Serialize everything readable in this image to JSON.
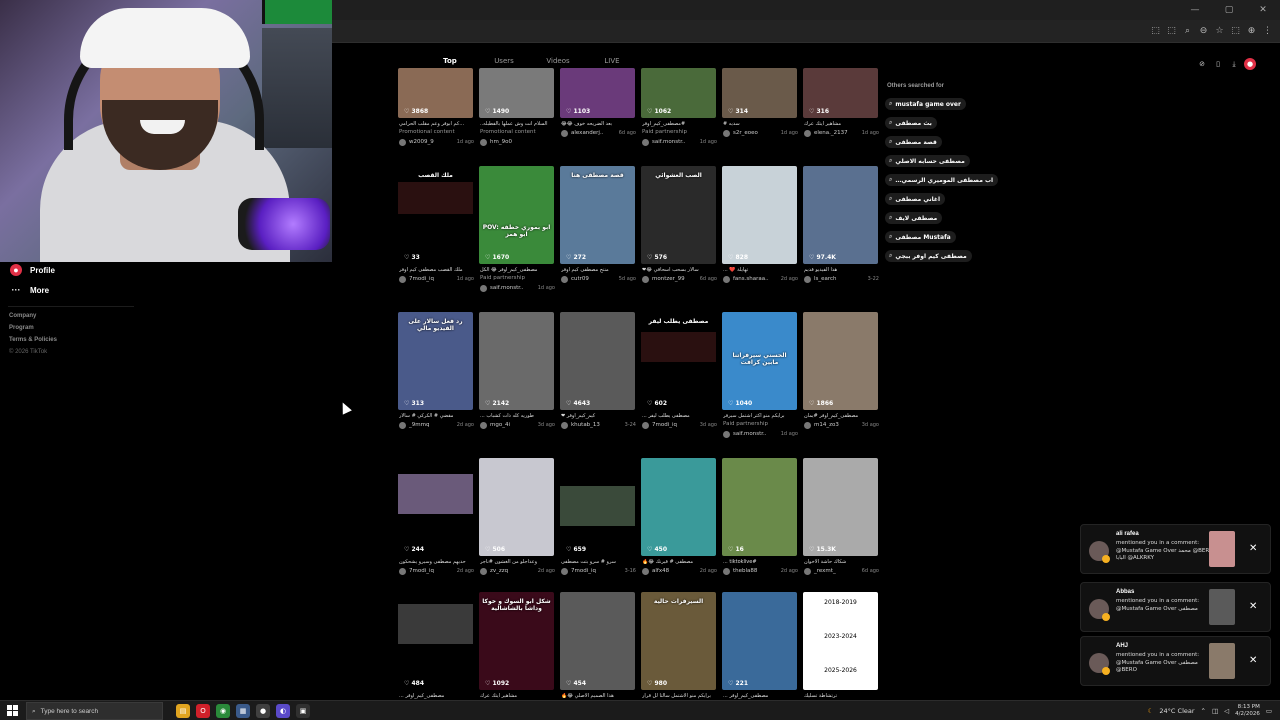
{
  "chrome": {
    "window_controls": [
      "—",
      "▢",
      "✕"
    ],
    "toolbar_icons": [
      "⬚",
      "⬚",
      "⌕",
      "⊖",
      "☆",
      "⬚",
      "⊕",
      "⋮"
    ]
  },
  "leftnav": {
    "profile_label": "Profile",
    "more_label": "More",
    "footer": [
      "Company",
      "Program",
      "Terms & Policies",
      "© 2026 TikTok"
    ]
  },
  "tabs": [
    {
      "label": "Top",
      "active": true
    },
    {
      "label": "Users",
      "active": false
    },
    {
      "label": "Videos",
      "active": false
    },
    {
      "label": "LIVE",
      "active": false
    }
  ],
  "videos": [
    {
      "likes": "3868",
      "caption": "…كم ابوفر وعم مقلب الحرامي",
      "sub": "Promotional content",
      "author": "w2009_9",
      "date": "1d ago",
      "color": "#8a6a55"
    },
    {
      "likes": "1490",
      "caption": "السلام انت وش عملها بالفطبله..",
      "sub": "Promotional content",
      "author": "hm_9o0",
      "date": "",
      "color": "#7a7a7a"
    },
    {
      "likes": "1103",
      "caption": "بعد الضريحه خوف 😂😂",
      "sub": "",
      "author": "alexanderj..",
      "date": "6d ago",
      "color": "#6a3a7a"
    },
    {
      "likes": "1062",
      "caption": "#مصطفى_كيم_اوفر",
      "sub": "Paid partnership",
      "author": "saif.monstr..",
      "date": "1d ago",
      "color": "#4a6a3a"
    },
    {
      "likes": "314",
      "caption": "سديه #",
      "sub": "",
      "author": "s2r_eoeo",
      "date": "1d ago",
      "color": "#6a5a4a"
    },
    {
      "likes": "316",
      "caption": "مشاهير ايتك عرك",
      "sub": "",
      "author": "elena._2137",
      "date": "1d ago",
      "color": "#5a3a3a"
    },
    {
      "likes": "33",
      "caption": "ملك القصب مصطفى كيم اوفر",
      "sub": "",
      "author": "7modi_iq",
      "date": "1d ago",
      "color": "#2a1010"
    },
    {
      "likes": "1670",
      "caption": "مصطفى_كيم_اوفر 😂 الكل",
      "sub": "Paid partnership",
      "author": "saif.monstr..",
      "date": "1d ago",
      "color": "#3a8a3a"
    },
    {
      "likes": "272",
      "caption": "منتج مصطفى كيم اوفر",
      "sub": "",
      "author": "cutr09",
      "date": "5d ago",
      "color": "#5a7a9a"
    },
    {
      "likes": "576",
      "caption": "سالار بسحب أسحاقي 😂❤",
      "sub": "",
      "author": "montzer_99",
      "date": "6d ago",
      "color": "#2a2a2a"
    },
    {
      "likes": "828",
      "caption": "تهايلة ❤️ ...",
      "sub": "",
      "author": "fans.sharaa..",
      "date": "2d ago",
      "color": "#c8d2d8"
    },
    {
      "likes": "97.4K",
      "caption": "هذا الفيديو قديم",
      "sub": "",
      "author": "ls_earch",
      "date": "3-22",
      "color": "#5a7090"
    },
    {
      "likes": "313",
      "caption": "مقضي # الكركي # سالار",
      "sub": "",
      "author": "_9mmq",
      "date": "2d ago",
      "color": "#4a5a8a"
    },
    {
      "likes": "2142",
      "caption": "طوريه كله ذات كشباب ...",
      "sub": "",
      "author": "mgo_4i",
      "date": "3d ago",
      "color": "#6a6a6a"
    },
    {
      "likes": "4643",
      "caption": "كيم_كيم_اوفر ❤",
      "sub": "",
      "author": "khutab_13",
      "date": "3-24",
      "color": "#5a5a5a"
    },
    {
      "likes": "602",
      "caption": "مصطفى يطلب ليفر ...",
      "sub": "",
      "author": "7modi_iq",
      "date": "3d ago",
      "color": "#2a1010"
    },
    {
      "likes": "1040",
      "caption": "برايكم منو اكثر اشتمل سيرفر",
      "sub": "Paid partnership",
      "author": "saif.monstr..",
      "date": "1d ago",
      "color": "#3a8acb"
    },
    {
      "likes": "1866",
      "caption": "مصطفى_كيم_اوفر #يمان",
      "sub": "",
      "author": "m14_zo3",
      "date": "3d ago",
      "color": "#8a7a6a"
    },
    {
      "likes": "244",
      "caption": "حديهم مصطفى وسيرو يشحكون",
      "sub": "",
      "author": "7modi_iq",
      "date": "2d ago",
      "color": "#6a5a7a"
    },
    {
      "likes": "506",
      "caption": "وعذاجلو من الغشون #ناجر",
      "sub": "",
      "author": "zv_zzq",
      "date": "2d ago",
      "color": "#c8c8d0"
    },
    {
      "likes": "659",
      "caption": "سرو # سرو بتت مصطفى",
      "sub": "",
      "author": "7modi_iq",
      "date": "3-16",
      "color": "#3a4a3a"
    },
    {
      "likes": "450",
      "caption": "مصطفى # قيرنك 😂🔥",
      "sub": "",
      "author": "alfx48",
      "date": "2d ago",
      "color": "#3a9a9a"
    },
    {
      "likes": "16",
      "caption": "#tiktoklive ...",
      "sub": "",
      "author": "thebla88",
      "date": "2d ago",
      "color": "#6a8a4a"
    },
    {
      "likes": "15.3K",
      "caption": "شكاك حاشة الاخوان",
      "sub": "",
      "author": "_rexmt_",
      "date": "6d ago",
      "color": "#aaaaaa"
    },
    {
      "likes": "484",
      "caption": "مصطفى_كيم_اوفر ...",
      "sub": "",
      "author": "",
      "date": "",
      "color": "#3a3a3a"
    },
    {
      "likes": "1092",
      "caption": "مشاهير ايتك عرك",
      "sub": "",
      "author": "",
      "date": "",
      "color": "#3a0a1a"
    },
    {
      "likes": "454",
      "caption": "هذا الصميم الاصلي 😂🔥",
      "sub": "",
      "author": "",
      "date": "",
      "color": "#5a5a5a"
    },
    {
      "likes": "980",
      "caption": "برايكم منو الاشتمل سالتا لل قرار",
      "sub": "",
      "author": "",
      "date": "",
      "color": "#6a5a3a"
    },
    {
      "likes": "221",
      "caption": "مصطفى_كيم_اوفر ...",
      "sub": "",
      "author": "",
      "date": "",
      "color": "#3a6a9a"
    },
    {
      "likes": "",
      "caption": "ترتشاطة تسليك",
      "sub": "",
      "author": "",
      "date": "",
      "color": "#ffffff"
    }
  ],
  "thumb_overlays": {
    "v6": "ملك القصب",
    "v7": "POV: ابو بموري خطفه ابو همز",
    "v8": "قصة مصطفى هنا",
    "v9": "الصب العشوائي",
    "v12": "رد فعل سالار على الفيديو مالي",
    "v15": "مصطفى يطلب ليفر",
    "v16": "الحسني سيرفراتنا مابين كرافت",
    "v25": "شكل ابو السوك و خوكا وداشا بالشاشالية",
    "v27": "السيرفرات حالية",
    "v29a": "2018-2019",
    "v29b": "2023-2024",
    "v29c": "2025-2026"
  },
  "others": {
    "title": "Others searched for",
    "items": [
      "mustafa game over",
      "بث مصطفى",
      "قصة مصطفى",
      "مصطفى حسابه الاصلي",
      "…اب مصطفى الموميري الرسمي",
      "اغاني مصطفى",
      "مصطفى لايف",
      "مصطفى Mustafa",
      "مصطفى كيم اوفر ببجي"
    ]
  },
  "tools": [
    "⊘",
    "▯",
    "⤓",
    "●"
  ],
  "notifications": [
    {
      "name": "ali rafea",
      "text": "mentioned you in a comment: @Mustafa Game Over محمد @BERO البابا @ALKRKY",
      "thumb": "#c89090"
    },
    {
      "name": "Abbas",
      "text": "mentioned you in a comment: @Mustafa Game Over مصطفى",
      "thumb": "#5a5a5a"
    },
    {
      "name": "AHJ",
      "text": "mentioned you in a comment: @Mustafa Game Over مصطفى @BERO",
      "thumb": "#8a7a6a"
    }
  ],
  "taskbar": {
    "search_placeholder": "Type here to search",
    "weather": "24°C  Clear",
    "time": "8:13 PM",
    "date": "4/2/2026",
    "apps": [
      {
        "icon": "▤",
        "color": "#e0a420"
      },
      {
        "icon": "O",
        "color": "#d0202a"
      },
      {
        "icon": "◉",
        "color": "#2a8a3a"
      },
      {
        "icon": "▦",
        "color": "#3a5a8a"
      },
      {
        "icon": "●",
        "color": "#404040"
      },
      {
        "icon": "◐",
        "color": "#5a4ac8"
      },
      {
        "icon": "▣",
        "color": "#303030"
      }
    ]
  }
}
